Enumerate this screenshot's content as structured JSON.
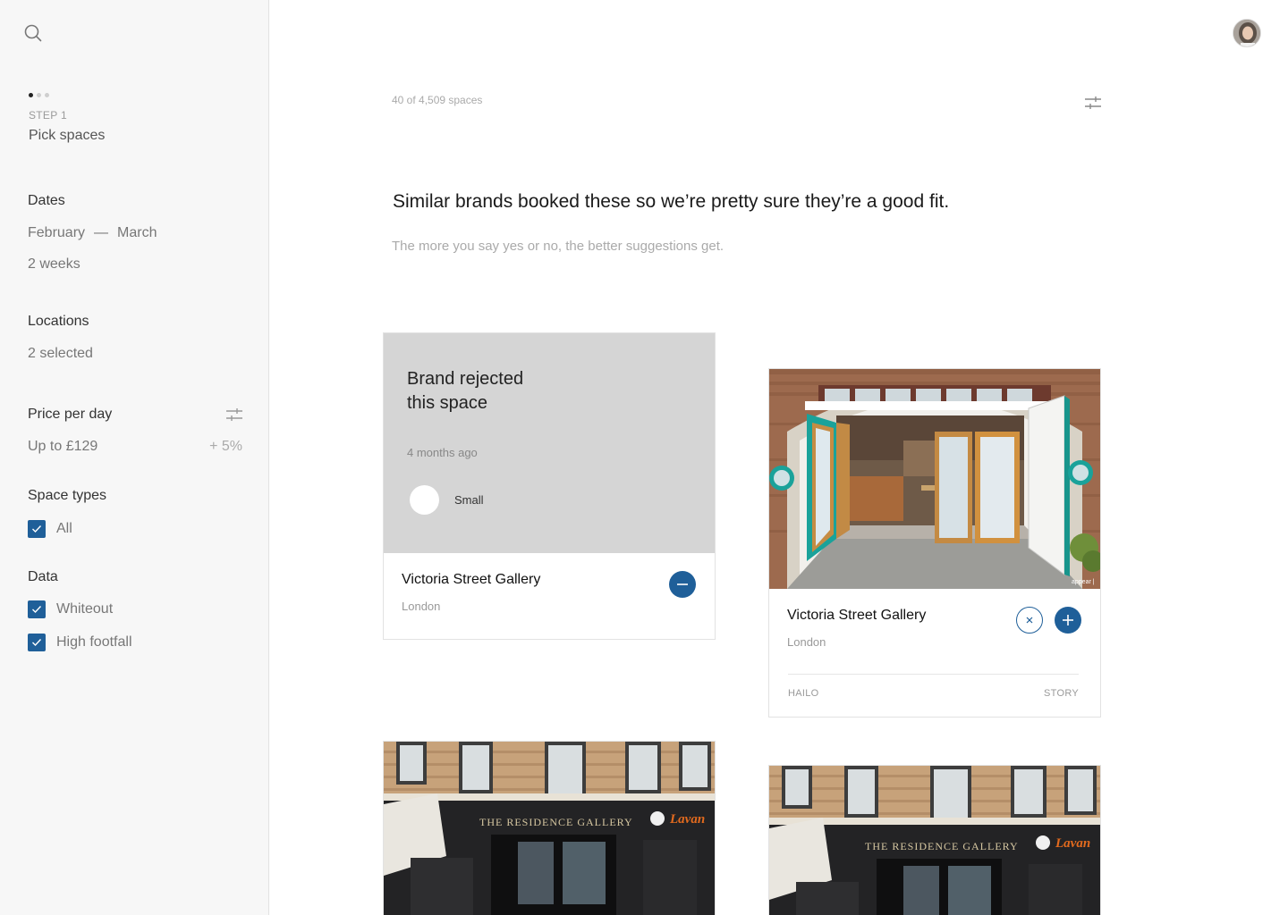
{
  "sidebar": {
    "step": {
      "label": "STEP 1",
      "title": "Pick spaces"
    },
    "dates": {
      "title": "Dates",
      "from": "February",
      "separator": "—",
      "to": "March",
      "duration": "2 weeks"
    },
    "locations": {
      "title": "Locations",
      "value": "2 selected"
    },
    "price": {
      "title": "Price per day",
      "value": "Up to £129",
      "adjustment": "+ 5%"
    },
    "space_types": {
      "title": "Space types",
      "options": [
        {
          "label": "All",
          "checked": true
        }
      ]
    },
    "data": {
      "title": "Data",
      "options": [
        {
          "label": "Whiteout",
          "checked": true
        },
        {
          "label": "High footfall",
          "checked": true
        }
      ]
    }
  },
  "main": {
    "count": "40 of 4,509 spaces",
    "headline": "Similar brands booked these so we’re pretty sure they’re a good fit.",
    "subline": "The more you say yes or no, the better suggestions get.",
    "cards": [
      {
        "status": "Brand rejected this space",
        "status_line1": "Brand rejected",
        "status_line2": "this space",
        "time": "4 months ago",
        "size": "Small",
        "name": "Victoria Street Gallery",
        "city": "London"
      },
      {
        "name": "Victoria Street Gallery",
        "city": "London",
        "tags": [
          "HAILO",
          "STORY"
        ],
        "photo_watermark": "appear |"
      },
      {
        "sign": "THE RESIDENCE GALLERY",
        "side_sign": "Lavan"
      },
      {
        "sign": "THE RESIDENCE GALLERY",
        "side_sign": "Lavan"
      }
    ]
  },
  "colors": {
    "accent": "#1f5f99",
    "sidebar_bg": "#f7f7f7",
    "rejected_bg": "#d5d5d5"
  }
}
